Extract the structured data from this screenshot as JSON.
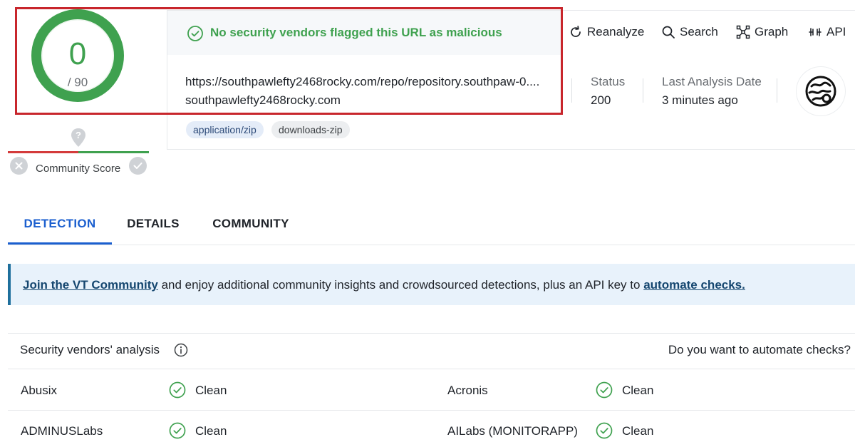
{
  "score": {
    "detections": "0",
    "total": "/ 90",
    "ratio": 0.0
  },
  "community_score": {
    "label": "Community Score",
    "unknown_symbol": "?"
  },
  "banner": {
    "text": "No security vendors flagged this URL as malicious"
  },
  "url": {
    "full": "https://southpawlefty2468rocky.com/repo/repository.southpaw-0....",
    "domain": "southpawlefty2468rocky.com",
    "tags": [
      "application/zip",
      "downloads-zip"
    ]
  },
  "stats": {
    "status_label": "Status",
    "status_value": "200",
    "date_label": "Last Analysis Date",
    "date_value": "3 minutes ago"
  },
  "toolbar": {
    "reanalyze": "Reanalyze",
    "search": "Search",
    "graph": "Graph",
    "api": "API"
  },
  "tabs": [
    {
      "label": "DETECTION",
      "active": true
    },
    {
      "label": "DETAILS",
      "active": false
    },
    {
      "label": "COMMUNITY",
      "active": false
    }
  ],
  "notice": {
    "link1": "Join the VT Community",
    "middle": " and enjoy additional community insights and crowdsourced detections, plus an API key to ",
    "link2": "automate checks."
  },
  "vendors": {
    "title": "Security vendors' analysis",
    "automate": "Do you want to automate checks?",
    "rows": [
      [
        {
          "name": "Abusix",
          "result": "Clean"
        },
        {
          "name": "Acronis",
          "result": "Clean"
        }
      ],
      [
        {
          "name": "ADMINUSLabs",
          "result": "Clean"
        },
        {
          "name": "AILabs (MONITORAPP)",
          "result": "Clean"
        }
      ]
    ]
  },
  "colors": {
    "clean_green": "#3fa14f",
    "accent_blue": "#1b5fcf",
    "highlight_red": "#c8262c",
    "malicious_red": "#d43b3b"
  },
  "icons": [
    "check-circle-icon",
    "refresh-icon",
    "search-icon",
    "graph-icon",
    "api-icon",
    "info-icon",
    "close-icon",
    "check-icon",
    "question-marker-icon",
    "vt-avatar-icon"
  ]
}
